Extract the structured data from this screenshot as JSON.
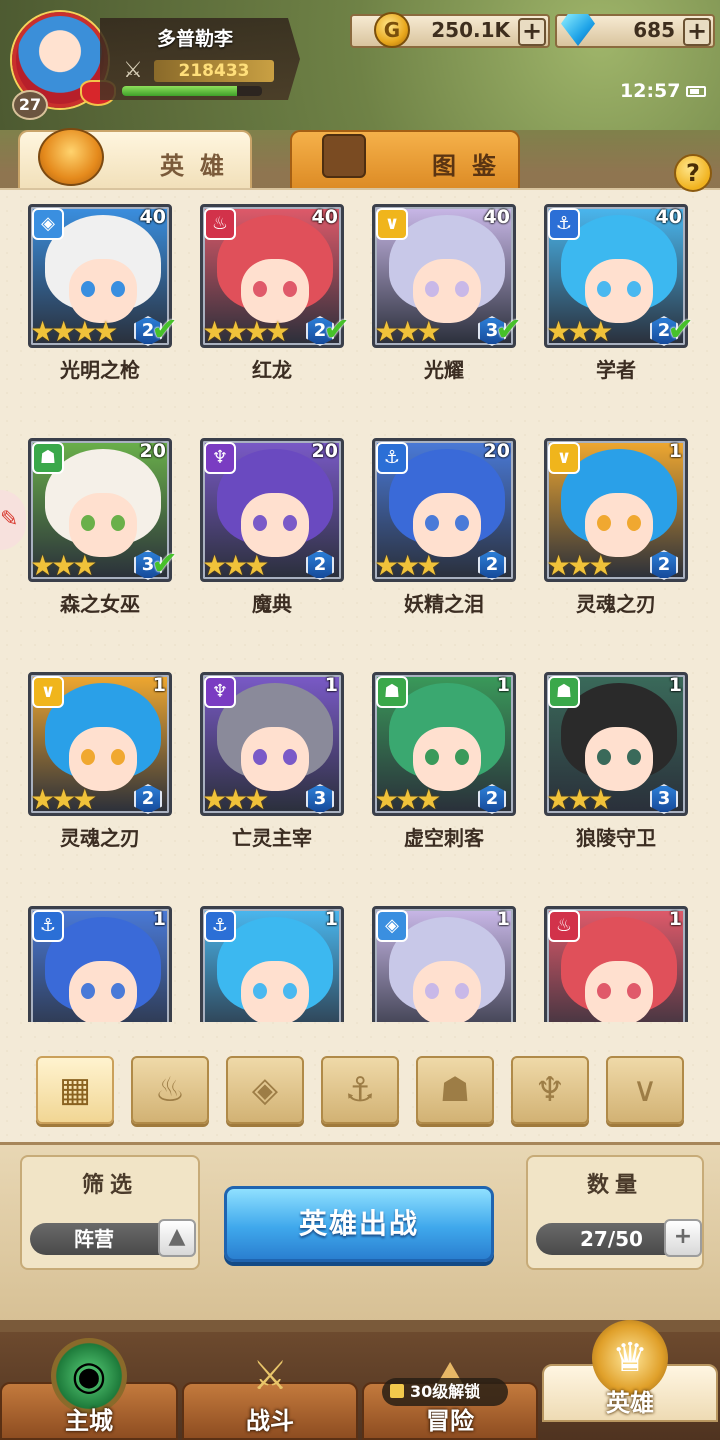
{
  "player": {
    "name": "多普勒李",
    "level": "27",
    "power": "218433",
    "exp_fraction": 0.82
  },
  "currency": {
    "gold": "250.1K",
    "gems": "685",
    "plus": "+"
  },
  "status": {
    "time": "12:57"
  },
  "tabs": {
    "heroes": "英雄",
    "codex": "图鉴"
  },
  "help_label": "?",
  "heroes": [
    {
      "name": "光明之枪",
      "level": "40",
      "stars": "★★★★",
      "rank": "2",
      "checked": true,
      "faction": "light"
    },
    {
      "name": "红龙",
      "level": "40",
      "stars": "★★★★",
      "rank": "2",
      "checked": true,
      "faction": "fire"
    },
    {
      "name": "光耀",
      "level": "40",
      "stars": "★★★",
      "rank": "3",
      "checked": true,
      "faction": "holy"
    },
    {
      "name": "学者",
      "level": "40",
      "stars": "★★★",
      "rank": "2",
      "checked": true,
      "faction": "sea"
    },
    {
      "name": "森之女巫",
      "level": "20",
      "stars": "★★★",
      "rank": "3",
      "checked": true,
      "faction": "beast"
    },
    {
      "name": "魔典",
      "level": "20",
      "stars": "★★★",
      "rank": "2",
      "checked": false,
      "faction": "dark"
    },
    {
      "name": "妖精之泪",
      "level": "20",
      "stars": "★★★",
      "rank": "2",
      "checked": false,
      "faction": "sea"
    },
    {
      "name": "灵魂之刃",
      "level": "1",
      "stars": "★★★",
      "rank": "2",
      "checked": false,
      "faction": "holy"
    },
    {
      "name": "灵魂之刃",
      "level": "1",
      "stars": "★★★",
      "rank": "2",
      "checked": false,
      "faction": "holy"
    },
    {
      "name": "亡灵主宰",
      "level": "1",
      "stars": "★★★",
      "rank": "3",
      "checked": false,
      "faction": "dark"
    },
    {
      "name": "虚空刺客",
      "level": "1",
      "stars": "★★★",
      "rank": "2",
      "checked": false,
      "faction": "beast"
    },
    {
      "name": "狼陵守卫",
      "level": "1",
      "stars": "★★★",
      "rank": "3",
      "checked": false,
      "faction": "beast"
    },
    {
      "name": "",
      "level": "1",
      "stars": "",
      "rank": "",
      "checked": false,
      "faction": "sea"
    },
    {
      "name": "",
      "level": "1",
      "stars": "",
      "rank": "",
      "checked": false,
      "faction": "sea"
    },
    {
      "name": "",
      "level": "1",
      "stars": "",
      "rank": "",
      "checked": false,
      "faction": "light"
    },
    {
      "name": "",
      "level": "1",
      "stars": "",
      "rank": "",
      "checked": false,
      "faction": "fire"
    }
  ],
  "faction_filters": [
    {
      "icon": "all-grid-icon",
      "glyph": "▦"
    },
    {
      "icon": "flame-icon",
      "glyph": "♨"
    },
    {
      "icon": "diamond-icon",
      "glyph": "◈"
    },
    {
      "icon": "anchor-icon",
      "glyph": "⚓"
    },
    {
      "icon": "beast-icon",
      "glyph": "☗"
    },
    {
      "icon": "horns-icon",
      "glyph": "♆"
    },
    {
      "icon": "chevron-icon",
      "glyph": "∨"
    }
  ],
  "filter_box": {
    "title": "筛选",
    "value": "阵营"
  },
  "deploy_label": "英雄出战",
  "count_box": {
    "title": "数量",
    "value": "27/50"
  },
  "nav": {
    "main_city": "主城",
    "battle": "战斗",
    "adventure": "冒险",
    "heroes": "英雄",
    "lock_text": "30级解锁"
  },
  "colors": {
    "light": "#3a8fe0",
    "fire": "#d2324a",
    "holy": "#f0b51c",
    "sea": "#2b6fd6",
    "beast": "#3aa84a",
    "dark": "#7a3cc2"
  }
}
